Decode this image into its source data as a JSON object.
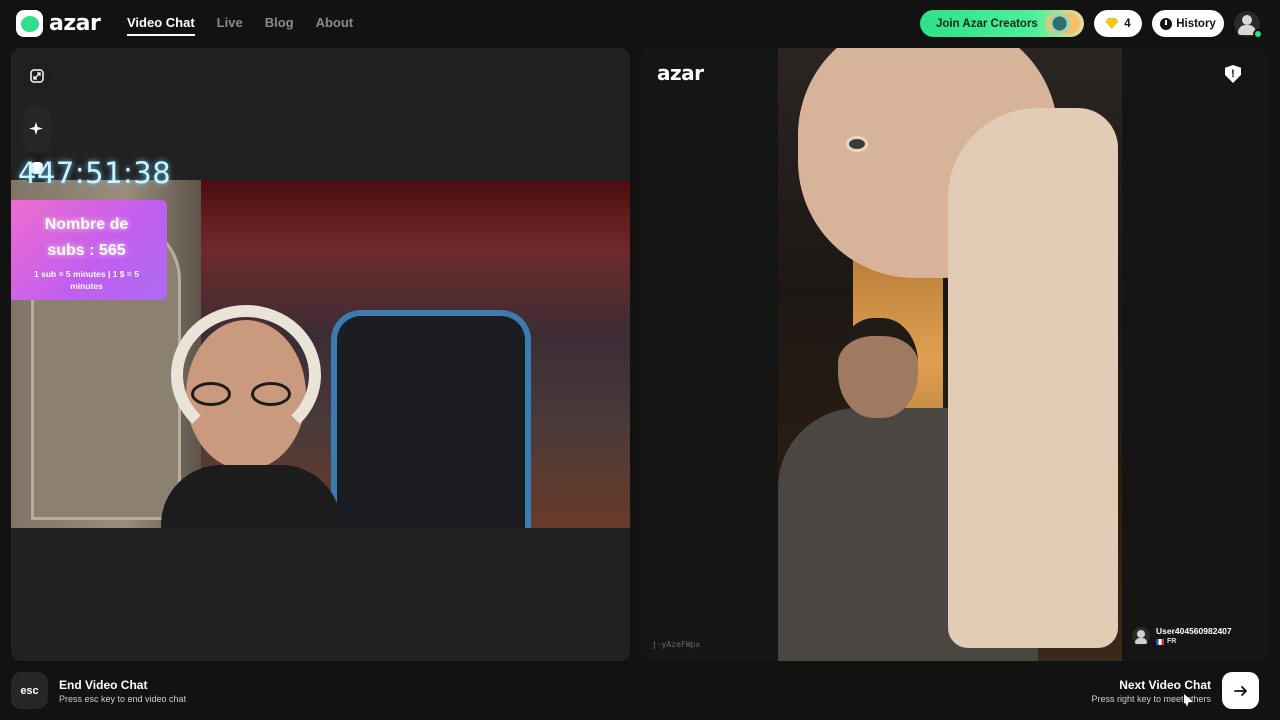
{
  "header": {
    "logo_text": "azar",
    "nav": [
      {
        "label": "Video Chat",
        "active": true
      },
      {
        "label": "Live",
        "active": false
      },
      {
        "label": "Blog",
        "active": false
      },
      {
        "label": "About",
        "active": false
      }
    ],
    "creators_label": "Join Azar Creators",
    "gem_count": "4",
    "history_label": "History"
  },
  "left": {
    "timer": "447:51:38",
    "subs_title_line1": "Nombre de",
    "subs_title_line2": "subs :  565",
    "subs_note": "1 sub = 5 minutes | 1 $ = 5 minutes"
  },
  "right": {
    "logo_text": "azar",
    "room_id": "j-yAzeFWpx",
    "user_name": "User404560982407",
    "user_country": "FR"
  },
  "footer": {
    "esc_key": "esc",
    "end_title": "End Video Chat",
    "end_hint": "Press esc key to end video chat",
    "next_title": "Next Video Chat",
    "next_hint": "Press right key to meet others"
  },
  "icons": {
    "expand": "expand-icon",
    "effects": "sparkle-icon",
    "sticker": "sticker-icon",
    "report": "report-shield-icon",
    "next": "arrow-right-icon"
  },
  "colors": {
    "brand_green": "#2fe08a",
    "background": "#121212",
    "panel": "#212121"
  }
}
